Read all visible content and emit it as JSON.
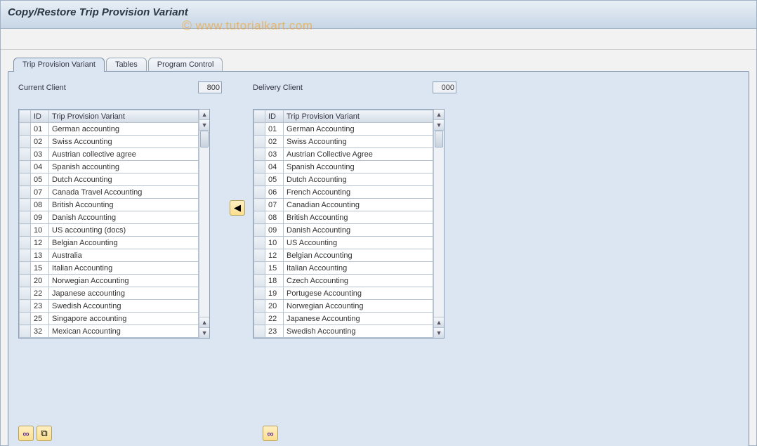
{
  "title": "Copy/Restore Trip Provision Variant",
  "watermark": "www.tutorialkart.com",
  "tabs": [
    {
      "label": "Trip Provision Variant",
      "active": true
    },
    {
      "label": "Tables",
      "active": false
    },
    {
      "label": "Program Control",
      "active": false
    }
  ],
  "leftPane": {
    "label": "Current Client",
    "value": "800",
    "columns": {
      "id": "ID",
      "name": "Trip Provision Variant"
    },
    "rows": [
      {
        "id": "01",
        "name": "German accounting"
      },
      {
        "id": "02",
        "name": "Swiss Accounting"
      },
      {
        "id": "03",
        "name": "Austrian collective agree"
      },
      {
        "id": "04",
        "name": "Spanish accounting"
      },
      {
        "id": "05",
        "name": "Dutch Accounting"
      },
      {
        "id": "07",
        "name": "Canada Travel Accounting"
      },
      {
        "id": "08",
        "name": "British Accounting"
      },
      {
        "id": "09",
        "name": "Danish Accounting"
      },
      {
        "id": "10",
        "name": "US accounting (docs)"
      },
      {
        "id": "12",
        "name": "Belgian Accounting"
      },
      {
        "id": "13",
        "name": "Australia"
      },
      {
        "id": "15",
        "name": "Italian Accounting"
      },
      {
        "id": "20",
        "name": "Norwegian Accounting"
      },
      {
        "id": "22",
        "name": "Japanese accounting"
      },
      {
        "id": "23",
        "name": "Swedish Accounting"
      },
      {
        "id": "25",
        "name": "Singapore accounting"
      },
      {
        "id": "32",
        "name": "Mexican Accounting"
      }
    ]
  },
  "transferButton": {
    "glyph": "◀"
  },
  "rightPane": {
    "label": "Delivery Client",
    "value": "000",
    "columns": {
      "id": "ID",
      "name": "Trip Provision Variant"
    },
    "rows": [
      {
        "id": "01",
        "name": "German Accounting"
      },
      {
        "id": "02",
        "name": "Swiss Accounting"
      },
      {
        "id": "03",
        "name": "Austrian Collective Agree"
      },
      {
        "id": "04",
        "name": "Spanish Accounting"
      },
      {
        "id": "05",
        "name": "Dutch Accounting"
      },
      {
        "id": "06",
        "name": "French Accounting"
      },
      {
        "id": "07",
        "name": "Canadian Accounting"
      },
      {
        "id": "08",
        "name": "British Accounting"
      },
      {
        "id": "09",
        "name": "Danish Accounting"
      },
      {
        "id": "10",
        "name": "US Accounting"
      },
      {
        "id": "12",
        "name": "Belgian Accounting"
      },
      {
        "id": "15",
        "name": "Italian Accounting"
      },
      {
        "id": "18",
        "name": "Czech Accounting"
      },
      {
        "id": "19",
        "name": "Portugese Accounting"
      },
      {
        "id": "20",
        "name": "Norwegian Accounting"
      },
      {
        "id": "22",
        "name": "Japanese Accounting"
      },
      {
        "id": "23",
        "name": "Swedish Accounting"
      }
    ]
  }
}
